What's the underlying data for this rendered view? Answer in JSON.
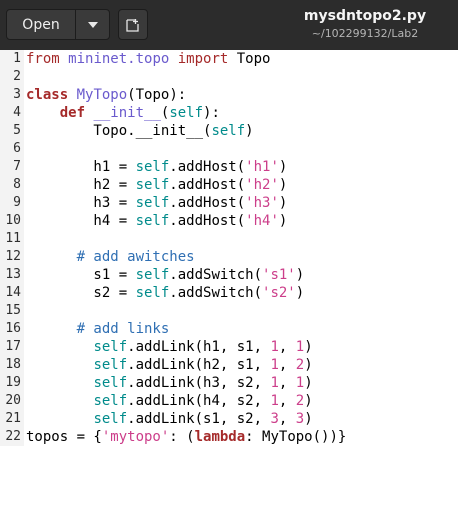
{
  "header": {
    "open_label": "Open",
    "filename": "mysdntopo2.py",
    "path": "~/102299132/Lab2"
  },
  "editor": {
    "lines": [
      {
        "n": "1",
        "spans": [
          {
            "t": "from ",
            "c": "imp"
          },
          {
            "t": "mininet.topo",
            "c": "mod"
          },
          {
            "t": " ",
            "c": ""
          },
          {
            "t": "import",
            "c": "imp"
          },
          {
            "t": " Topo",
            "c": ""
          }
        ]
      },
      {
        "n": "2",
        "spans": []
      },
      {
        "n": "3",
        "spans": [
          {
            "t": "class",
            "c": "kw"
          },
          {
            "t": " ",
            "c": ""
          },
          {
            "t": "MyTopo",
            "c": "cls"
          },
          {
            "t": "(Topo):",
            "c": ""
          }
        ]
      },
      {
        "n": "4",
        "spans": [
          {
            "t": "    ",
            "c": ""
          },
          {
            "t": "def",
            "c": "kw"
          },
          {
            "t": " ",
            "c": ""
          },
          {
            "t": "__init__",
            "c": "cls"
          },
          {
            "t": "(",
            "c": ""
          },
          {
            "t": "self",
            "c": "slf"
          },
          {
            "t": "):",
            "c": ""
          }
        ]
      },
      {
        "n": "5",
        "spans": [
          {
            "t": "        Topo.__init__(",
            "c": ""
          },
          {
            "t": "self",
            "c": "slf"
          },
          {
            "t": ")",
            "c": ""
          }
        ]
      },
      {
        "n": "6",
        "spans": []
      },
      {
        "n": "7",
        "spans": [
          {
            "t": "        h1 = ",
            "c": ""
          },
          {
            "t": "self",
            "c": "slf"
          },
          {
            "t": ".addHost(",
            "c": ""
          },
          {
            "t": "'h1'",
            "c": "str"
          },
          {
            "t": ")",
            "c": ""
          }
        ]
      },
      {
        "n": "8",
        "spans": [
          {
            "t": "        h2 = ",
            "c": ""
          },
          {
            "t": "self",
            "c": "slf"
          },
          {
            "t": ".addHost(",
            "c": ""
          },
          {
            "t": "'h2'",
            "c": "str"
          },
          {
            "t": ")",
            "c": ""
          }
        ]
      },
      {
        "n": "9",
        "spans": [
          {
            "t": "        h3 = ",
            "c": ""
          },
          {
            "t": "self",
            "c": "slf"
          },
          {
            "t": ".addHost(",
            "c": ""
          },
          {
            "t": "'h3'",
            "c": "str"
          },
          {
            "t": ")",
            "c": ""
          }
        ]
      },
      {
        "n": "10",
        "spans": [
          {
            "t": "        h4 = ",
            "c": ""
          },
          {
            "t": "self",
            "c": "slf"
          },
          {
            "t": ".addHost(",
            "c": ""
          },
          {
            "t": "'h4'",
            "c": "str"
          },
          {
            "t": ")",
            "c": ""
          }
        ]
      },
      {
        "n": "11",
        "spans": []
      },
      {
        "n": "12",
        "spans": [
          {
            "t": "      ",
            "c": ""
          },
          {
            "t": "# add awitches",
            "c": "cmt"
          }
        ]
      },
      {
        "n": "13",
        "spans": [
          {
            "t": "        s1 = ",
            "c": ""
          },
          {
            "t": "self",
            "c": "slf"
          },
          {
            "t": ".addSwitch(",
            "c": ""
          },
          {
            "t": "'s1'",
            "c": "str"
          },
          {
            "t": ")",
            "c": ""
          }
        ]
      },
      {
        "n": "14",
        "spans": [
          {
            "t": "        s2 = ",
            "c": ""
          },
          {
            "t": "self",
            "c": "slf"
          },
          {
            "t": ".addSwitch(",
            "c": ""
          },
          {
            "t": "'s2'",
            "c": "str"
          },
          {
            "t": ")",
            "c": ""
          }
        ]
      },
      {
        "n": "15",
        "spans": []
      },
      {
        "n": "16",
        "spans": [
          {
            "t": "      ",
            "c": ""
          },
          {
            "t": "# add links",
            "c": "cmt"
          }
        ]
      },
      {
        "n": "17",
        "spans": [
          {
            "t": "        ",
            "c": ""
          },
          {
            "t": "self",
            "c": "slf"
          },
          {
            "t": ".addLink(h1, s1, ",
            "c": ""
          },
          {
            "t": "1",
            "c": "num"
          },
          {
            "t": ", ",
            "c": ""
          },
          {
            "t": "1",
            "c": "num"
          },
          {
            "t": ")",
            "c": ""
          }
        ]
      },
      {
        "n": "18",
        "spans": [
          {
            "t": "        ",
            "c": ""
          },
          {
            "t": "self",
            "c": "slf"
          },
          {
            "t": ".addLink(h2, s1, ",
            "c": ""
          },
          {
            "t": "1",
            "c": "num"
          },
          {
            "t": ", ",
            "c": ""
          },
          {
            "t": "2",
            "c": "num"
          },
          {
            "t": ")",
            "c": ""
          }
        ]
      },
      {
        "n": "19",
        "spans": [
          {
            "t": "        ",
            "c": ""
          },
          {
            "t": "self",
            "c": "slf"
          },
          {
            "t": ".addLink(h3, s2, ",
            "c": ""
          },
          {
            "t": "1",
            "c": "num"
          },
          {
            "t": ", ",
            "c": ""
          },
          {
            "t": "1",
            "c": "num"
          },
          {
            "t": ")",
            "c": ""
          }
        ]
      },
      {
        "n": "20",
        "spans": [
          {
            "t": "        ",
            "c": ""
          },
          {
            "t": "self",
            "c": "slf"
          },
          {
            "t": ".addLink(h4, s2, ",
            "c": ""
          },
          {
            "t": "1",
            "c": "num"
          },
          {
            "t": ", ",
            "c": ""
          },
          {
            "t": "2",
            "c": "num"
          },
          {
            "t": ")",
            "c": ""
          }
        ]
      },
      {
        "n": "21",
        "spans": [
          {
            "t": "        ",
            "c": ""
          },
          {
            "t": "self",
            "c": "slf"
          },
          {
            "t": ".addLink(s1, s2, ",
            "c": ""
          },
          {
            "t": "3",
            "c": "num"
          },
          {
            "t": ", ",
            "c": ""
          },
          {
            "t": "3",
            "c": "num"
          },
          {
            "t": ")",
            "c": ""
          }
        ]
      },
      {
        "n": "22",
        "spans": [
          {
            "t": "topos = {",
            "c": ""
          },
          {
            "t": "'mytopo'",
            "c": "str"
          },
          {
            "t": ": (",
            "c": ""
          },
          {
            "t": "lambda",
            "c": "kw"
          },
          {
            "t": ": MyTopo())}",
            "c": ""
          }
        ]
      }
    ]
  },
  "colors": {
    "headerbar": "#2c2c2c",
    "keyword": "#a52a2a",
    "string": "#cc3e8a",
    "self": "#008b8b",
    "comment": "#2f6fb3"
  },
  "icons": {
    "dropdown": "chevron-down-icon",
    "new_tab": "new-document-icon"
  }
}
